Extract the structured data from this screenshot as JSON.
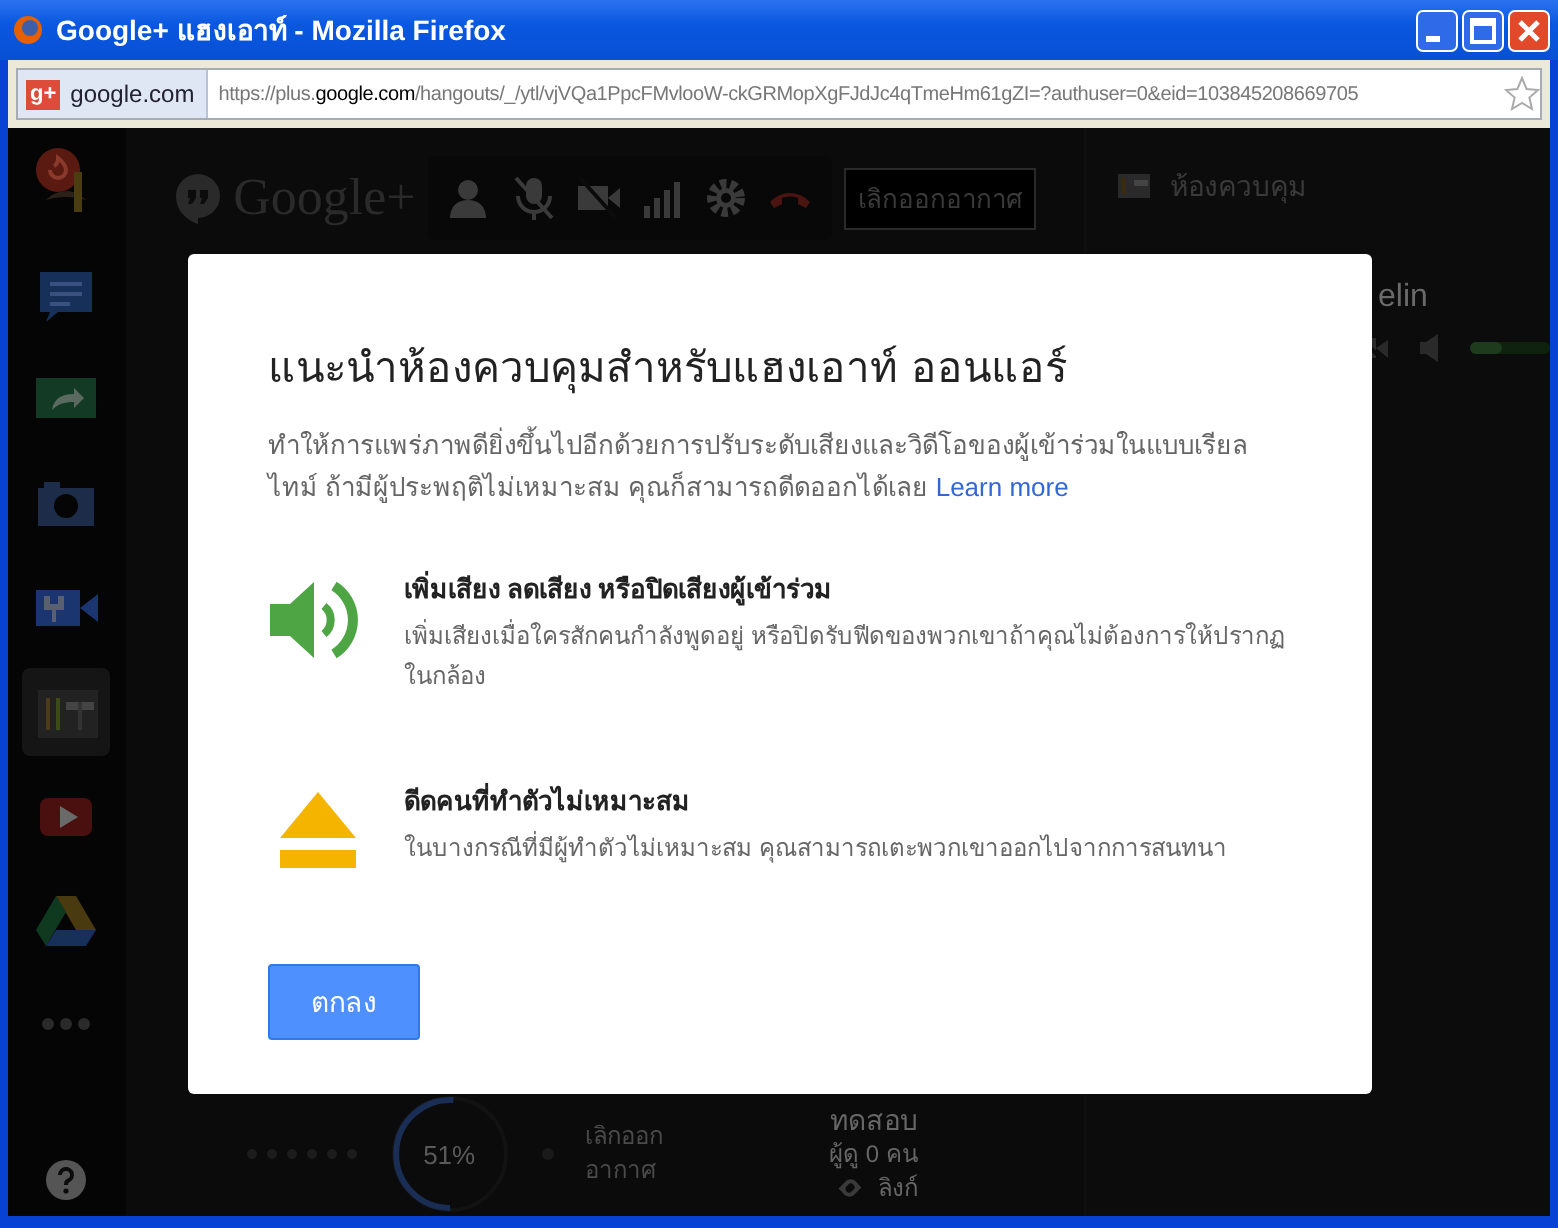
{
  "window": {
    "title": "Google+ แฮงเอาท์ - Mozilla Firefox"
  },
  "address_bar": {
    "site_badge": "g+",
    "site": "google.com",
    "url": {
      "prefix": "https://plus.",
      "domain": "google.com",
      "path": "/hangouts/_/ytl/vjVQa1PpcFMvlooW-ckGRMopXgFJdJc4qTmeHm61gZI=?authuser=0&eid=103845208669705"
    }
  },
  "apps": [
    {
      "kind": "chat",
      "selected": false
    },
    {
      "kind": "screenshare",
      "selected": false
    },
    {
      "kind": "camera",
      "selected": false
    },
    {
      "kind": "video-tools",
      "selected": false
    },
    {
      "kind": "control-room",
      "selected": true
    },
    {
      "kind": "youtube",
      "selected": false
    },
    {
      "kind": "drive",
      "selected": false
    },
    {
      "kind": "more",
      "selected": false
    }
  ],
  "toolbar": {
    "logo": "Google+",
    "end_broadcast": "เลิกออกอากาศ"
  },
  "right_panel": {
    "title": "ห้องควบคุม",
    "participant": "elin",
    "volume": {
      "level": 0.4
    }
  },
  "bottom": {
    "progress": {
      "level": 0.51,
      "reading": "51%"
    },
    "end_broadcast": "เลิกออก อากาศ",
    "title": "ทดสอบ",
    "viewers": "ผู้ดู 0 คน",
    "link": "ลิงก์"
  },
  "dialog": {
    "title": "แนะนำห้องควบคุมสำหรับแฮงเอาท์ ออนแอร์",
    "description": "ทำให้การแพร่ภาพดียิ่งขึ้นไปอีกด้วยการปรับระดับเสียงและวิดีโอของผู้เข้าร่วมในแบบเรียลไทม์ ถ้ามีผู้ประพฤติไม่เหมาะสม คุณก็สามารถดีดออกได้เลย",
    "link": "Learn more",
    "features": [
      {
        "kind": "volume",
        "title": "เพิ่มเสียง ลดเสียง หรือปิดเสียงผู้เข้าร่วม",
        "text": "เพิ่มเสียงเมื่อใครสักคนกำลังพูดอยู่ หรือปิดรับฟีดของพวกเขาถ้าคุณไม่ต้องการให้ปรากฏในกล้อง"
      },
      {
        "kind": "eject",
        "title": "ดีดคนที่ทำตัวไม่เหมาะสม",
        "text": "ในบางกรณีที่มีผู้ทำตัวไม่เหมาะสม คุณสามารถเตะพวกเขาออกไปจากการสนทนา"
      }
    ],
    "ok_button": "ตกลง"
  }
}
